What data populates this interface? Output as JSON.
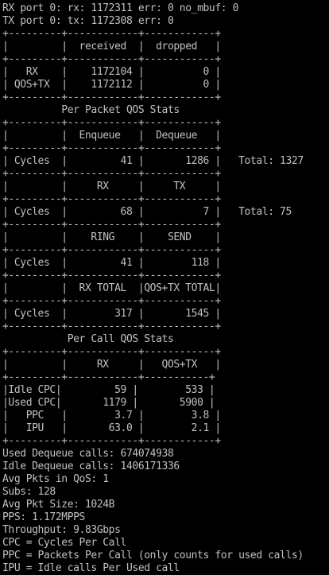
{
  "terminal": {
    "background": "#000000",
    "foreground": "#c0c0c0",
    "lines": [
      "RX port 0: rx: 1172311 err: 0 no_mbuf: 0",
      "TX port 0: tx: 1172308 err: 0",
      "+---------+------------+------------+",
      "|         |  received  |  dropped   |",
      "+---------+------------+------------+",
      "|   RX    |    1172104 |          0 |",
      "| QOS+TX  |    1172112 |          0 |",
      "+---------+------------+------------+",
      "          Per Packet QOS Stats",
      "+---------+------------+------------+",
      "|         |  Enqueue   |  Dequeue   |",
      "+---------+------------+------------+",
      "| Cycles  |         41 |       1286 |   Total: 1327",
      "+---------+------------+------------+",
      "|         |     RX     |     TX     |",
      "+---------+------------+------------+",
      "| Cycles  |         68 |          7 |   Total: 75",
      "+---------+------------+------------+",
      "|         |    RING    |    SEND    |",
      "+---------+------------+------------+",
      "| Cycles  |         41 |        118 |",
      "+---------+------------+------------+",
      "|         |  RX TOTAL  |QOS+TX TOTAL|",
      "+---------+------------+------------+",
      "| Cycles  |        317 |       1545 |",
      "+---------+------------+------------+",
      "           Per Call QOS Stats",
      "+---------+------------+------------+",
      "|         |     RX     |   QOS+TX   |",
      "+---------+------------+-----------+",
      "|Idle CPC|         59 |        533 |",
      "|Used CPC|       1179 |       5900 |",
      "|   PPC   |        3.7 |        3.8 |",
      "|   IPU   |       63.0 |        2.1 |",
      "+---------+------------+------------+",
      "Used Dequeue calls: 674074938",
      "Idle Dequeue calls: 1406171336",
      "Avg Pkts in QoS: 1",
      "Subs: 128",
      "Avg Pkt Size: 1024B",
      "PPS: 1.172MPPS",
      "Throughput: 9.83Gbps",
      "CPC = Cycles Per Call",
      "PPC = Packets Per Call (only counts for used calls)",
      "IPU = Idle calls Per Used call"
    ]
  }
}
